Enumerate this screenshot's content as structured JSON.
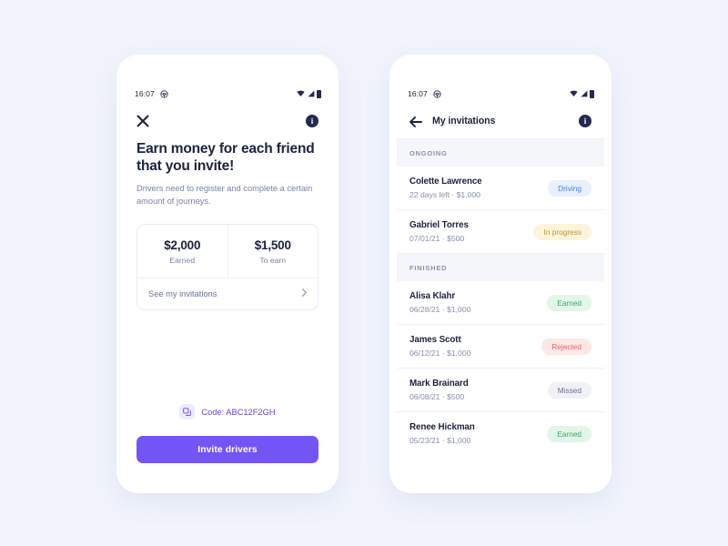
{
  "background_color": "#F1F4FC",
  "accent_color": "#7355F5",
  "status_bar": {
    "time": "16:07",
    "wheel_icon": "steering-wheel-icon",
    "wifi_icon": "wifi-icon",
    "signal_icon": "signal-icon",
    "battery_icon": "battery-icon"
  },
  "invite_screen": {
    "close_icon": "close-icon",
    "info_icon": "info-icon",
    "headline": "Earn money for each friend that you invite!",
    "subtext": "Drivers need to register and complete a certain amount of journeys.",
    "stats": [
      {
        "value": "$2,000",
        "label": "Earned"
      },
      {
        "value": "$1,500",
        "label": "To earn"
      }
    ],
    "see_invitations_label": "See my invitations",
    "chevron_icon": "chevron-right-icon",
    "copy_icon": "copy-icon",
    "code_label": "Code: ABC12F2GH",
    "invite_button_label": "Invite drivers"
  },
  "invitations_screen": {
    "back_icon": "arrow-left-icon",
    "title": "My invitations",
    "info_icon": "info-icon",
    "sections": [
      {
        "header": "ONGOING",
        "rows": [
          {
            "name": "Colette Lawrence",
            "meta": "22 days left · $1,000",
            "badge": "Driving",
            "badge_bg": "#E8EFFD",
            "badge_fg": "#4A7FE8"
          },
          {
            "name": "Gabriel Torres",
            "meta": "07/01/21 · $500",
            "badge": "In progress",
            "badge_bg": "#FDF4DC",
            "badge_fg": "#BC9540"
          }
        ]
      },
      {
        "header": "FINISHED",
        "rows": [
          {
            "name": "Alisa Klahr",
            "meta": "06/28/21 · $1,000",
            "badge": "Earned",
            "badge_bg": "#E2F6E9",
            "badge_fg": "#3BA868"
          },
          {
            "name": "James Scott",
            "meta": "06/12/21 · $1,000",
            "badge": "Rejected",
            "badge_bg": "#FDE7E7",
            "badge_fg": "#E9636A"
          },
          {
            "name": "Mark Brainard",
            "meta": "06/08/21 · $500",
            "badge": "Missed",
            "badge_bg": "#F0F1F6",
            "badge_fg": "#6C7391"
          },
          {
            "name": "Renee Hickman",
            "meta": "05/23/21 · $1,000",
            "badge": "Earned",
            "badge_bg": "#E2F6E9",
            "badge_fg": "#3BA868"
          }
        ]
      }
    ]
  }
}
